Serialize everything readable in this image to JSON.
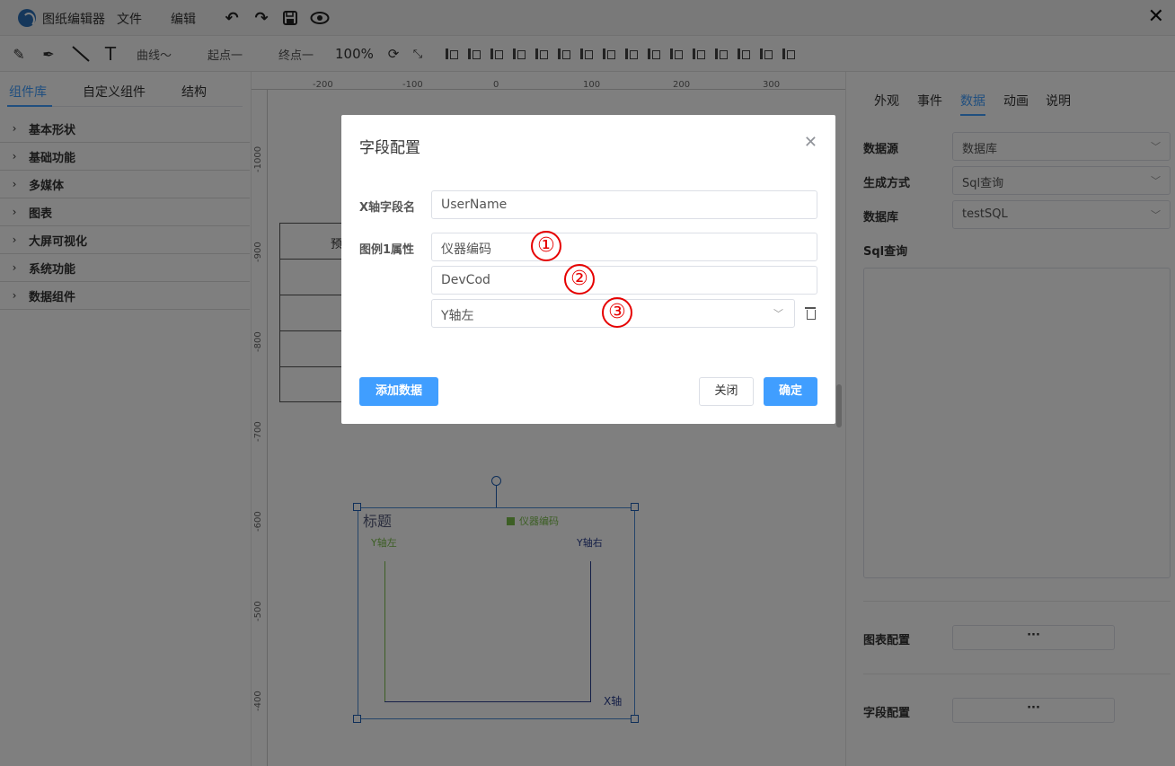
{
  "titlebar": {
    "app_title": "图纸编辑器",
    "menu": [
      "文件",
      "编辑"
    ],
    "icons": [
      "undo-icon",
      "redo-icon",
      "save-icon",
      "preview-eye-icon"
    ],
    "close": "✕"
  },
  "toolbar": {
    "curve_label": "曲线〜",
    "start_label": "起点一",
    "end_label": "终点一",
    "zoom": "100%"
  },
  "left_panel": {
    "tabs": [
      "组件库",
      "自定义组件",
      "结构"
    ],
    "categories": [
      "基本形状",
      "基础功能",
      "多媒体",
      "图表",
      "大屏可视化",
      "系统功能",
      "数据组件"
    ]
  },
  "canvas": {
    "ruler_top": [
      "-200",
      "-100",
      "0",
      "100",
      "200",
      "300"
    ],
    "ruler_left": [
      "-1000",
      "-900",
      "-800",
      "-700",
      "-600",
      "-500",
      "-400"
    ],
    "table_header": "预",
    "chart": {
      "title": "标题",
      "legend": "仪器编码",
      "y_left": "Y轴左",
      "y_right": "Y轴右",
      "x_axis": "X轴",
      "left_axis_color": "#7bbf4a",
      "right_axis_color": "#2a3f8f"
    }
  },
  "right_panel": {
    "tabs": [
      "外观",
      "事件",
      "数据",
      "动画",
      "说明"
    ],
    "active_tab": "数据",
    "fields": [
      {
        "label": "数据源",
        "value": "数据库"
      },
      {
        "label": "生成方式",
        "value": "Sql查询"
      },
      {
        "label": "数据库",
        "value": "testSQL"
      }
    ],
    "sql_label": "Sql查询",
    "chart_config_label": "图表配置",
    "field_config_label": "字段配置",
    "ellipsis": "···"
  },
  "dialog": {
    "title": "字段配置",
    "x_field_label": "X轴字段名",
    "x_field_value": "UserName",
    "legend_label": "图例1属性",
    "legend_name_value": "仪器编码",
    "legend_field_value": "DevCod",
    "axis_select_value": "Y轴左",
    "add_button": "添加数据",
    "close_button": "关闭",
    "ok_button": "确定",
    "annotations": [
      "①",
      "②",
      "③"
    ],
    "accent": "#409eff"
  }
}
